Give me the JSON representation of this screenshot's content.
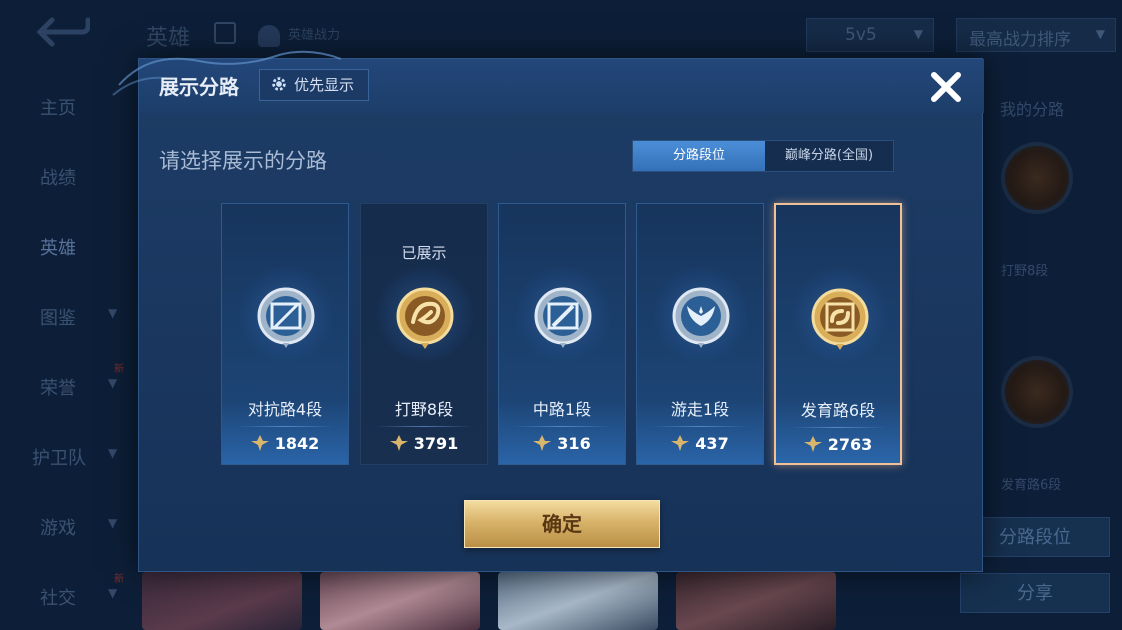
{
  "background": {
    "page_title": "英雄",
    "subtitle": "英雄战力",
    "mode_select": "5v5",
    "sort_select": "最高战力排序",
    "sidebar": [
      {
        "label": "主页",
        "has_chevron": false
      },
      {
        "label": "战绩",
        "has_chevron": false
      },
      {
        "label": "英雄",
        "has_chevron": false,
        "active": true
      },
      {
        "label": "图鉴",
        "has_chevron": true
      },
      {
        "label": "荣誉",
        "has_chevron": true,
        "badge": "新"
      },
      {
        "label": "护卫队",
        "has_chevron": true
      },
      {
        "label": "游戏",
        "has_chevron": true
      },
      {
        "label": "社交",
        "has_chevron": true,
        "badge": "新"
      }
    ],
    "right_panel": {
      "heading": "我的分路",
      "lanes": [
        "打野8段",
        "发育路6段"
      ],
      "lane_rank_button": "分路段位",
      "share_button": "分享"
    }
  },
  "modal": {
    "title": "展示分路",
    "priority_button": "优先显示",
    "prompt": "请选择展示的分路",
    "tabs": [
      {
        "label": "分路段位",
        "selected": true
      },
      {
        "label": "巅峰分路(全国)",
        "selected": false
      }
    ],
    "cards": [
      {
        "lane": "对抗路4段",
        "score": "1842",
        "emblem": "sword-emblem-icon",
        "tier": "silver",
        "shown": "",
        "selected": false
      },
      {
        "lane": "打野8段",
        "score": "3791",
        "emblem": "dragon-emblem-icon",
        "tier": "gold",
        "shown": "已展示",
        "selected": false
      },
      {
        "lane": "中路1段",
        "score": "316",
        "emblem": "staff-emblem-icon",
        "tier": "silver",
        "shown": "",
        "selected": false
      },
      {
        "lane": "游走1段",
        "score": "437",
        "emblem": "wings-emblem-icon",
        "tier": "silver",
        "shown": "",
        "selected": false
      },
      {
        "lane": "发育路6段",
        "score": "2763",
        "emblem": "bow-emblem-icon",
        "tier": "gold",
        "shown": "",
        "selected": true
      }
    ],
    "confirm_button": "确定",
    "colors": {
      "accent_blue": "#3f82cc",
      "gold": "#d8b36a",
      "selected_border": "#f0c096"
    }
  }
}
